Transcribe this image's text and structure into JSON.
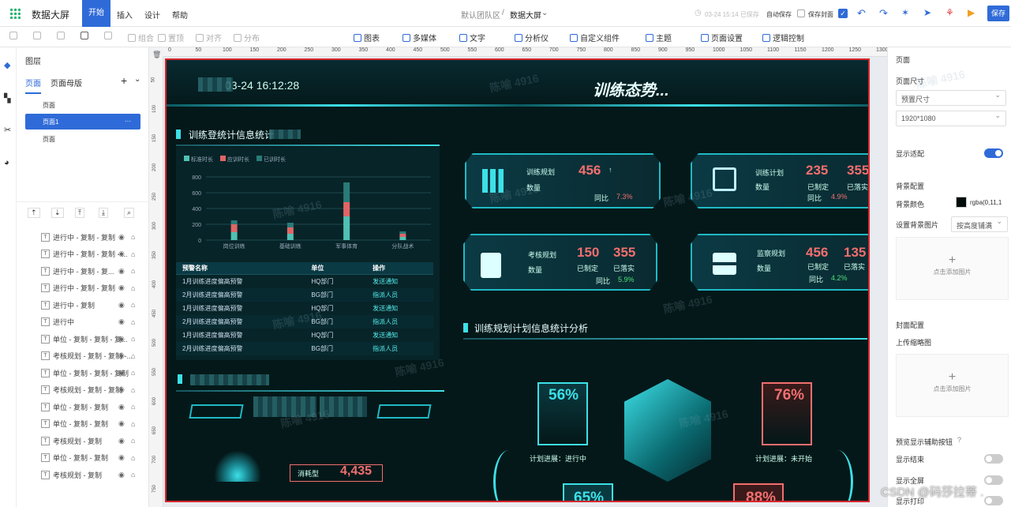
{
  "app": {
    "title": "数据大屏",
    "menu": [
      "开始",
      "插入",
      "设计",
      "帮助"
    ],
    "breadcrumb_team": "默认团队区",
    "breadcrumb_page": "数据大屏",
    "save_time": "03-24 15:14 已保存",
    "autosave": "自动保存",
    "save_cover": "保存封面",
    "save": "保存"
  },
  "toolbar": [
    "组合",
    "置顶",
    "对齐",
    "分布",
    "图表",
    "多媒体",
    "文字",
    "分析仪",
    "自定义组件",
    "主题",
    "页面设置",
    "逻辑控制"
  ],
  "layers": {
    "title": "图层",
    "tabs": [
      "页面",
      "页面母版"
    ],
    "pages": [
      "页面",
      "页面1",
      "页面"
    ],
    "items": [
      "进行中 - 复制 - 复制",
      "进行中 - 复制 - 复制 - ...",
      "进行中 - 复制 - 复...",
      "进行中 - 复制 - 复制",
      "进行中 - 复制",
      "进行中",
      "单位 - 复制 - 复制 - 复...",
      "考核规划 - 复制 - 复制 -...",
      "单位 - 复制 - 复制 - 复制",
      "考核规划 - 复制 - 复制",
      "单位 - 复制 - 复制",
      "单位 - 复制 - 复制",
      "考核规划 - 复制",
      "单位 - 复制 - 复制",
      "考核规划 - 复制"
    ]
  },
  "ruler": [
    "0",
    "50",
    "100",
    "150",
    "200",
    "250",
    "300",
    "350",
    "400",
    "450",
    "500",
    "550",
    "600",
    "650",
    "700",
    "750",
    "800",
    "850",
    "900",
    "950",
    "1000",
    "1050",
    "1100",
    "1150",
    "1200",
    "1250",
    "1300"
  ],
  "ruler_left": [
    "50",
    "100",
    "150",
    "200",
    "250",
    "300",
    "350",
    "400",
    "450",
    "500",
    "550",
    "600",
    "650",
    "700",
    "750"
  ],
  "right": {
    "page": "页面",
    "size_label": "页面尺寸",
    "size_preset": "预置尺寸",
    "size_value": "1920*1080",
    "fit": "显示适配",
    "bg_config": "背景配置",
    "bg_color": "背景颜色",
    "bg_color_value": "rgba(0,11,1",
    "bg_image": "设置背景图片",
    "bg_mode": "按高度铺满",
    "add_image": "点击添加图片",
    "cover_config": "封面配置",
    "upload_thumb": "上传缩略图",
    "preview_btns": "预览显示辅助按钮",
    "show_end": "显示结束",
    "show_full": "显示全屏",
    "show_print": "显示打印"
  },
  "screen": {
    "time": "03-24 16:12:28",
    "header": "训练态势...",
    "panel1": "训练登统计信息统计",
    "legend": [
      "标准时长",
      "应训时长",
      "已训时长"
    ],
    "chart_data": {
      "type": "bar",
      "categories": [
        "岗位训练",
        "基础训练",
        "军事体育",
        "分队战术"
      ],
      "series": [
        {
          "name": "标准时长",
          "values": [
            100,
            80,
            300,
            40
          ]
        },
        {
          "name": "应训时长",
          "values": [
            100,
            80,
            180,
            40
          ]
        },
        {
          "name": "已训时长",
          "values": [
            50,
            60,
            250,
            30
          ]
        }
      ],
      "ylim": [
        0,
        800
      ],
      "yticks": [
        "800",
        "600",
        "400",
        "200",
        "0"
      ]
    },
    "table": {
      "headers": [
        "预警名称",
        "单位",
        "操作"
      ],
      "rows": [
        [
          "1月训练进度偏高预警",
          "HQ部门",
          "发送通知"
        ],
        [
          "2月训练进度偏高预警",
          "BG部门",
          "指派人员"
        ],
        [
          "1月训练进度偏高预警",
          "HQ部门",
          "发送通知"
        ],
        [
          "2月训练进度偏高预警",
          "BG部门",
          "指派人员"
        ],
        [
          "1月训练进度偏高预警",
          "HQ部门",
          "发送通知"
        ],
        [
          "2月训练进度偏高预警",
          "BG部门",
          "指派人员"
        ]
      ]
    },
    "consume_label": "消耗型",
    "consume_value": "4,435",
    "cards": [
      {
        "title": "训练规划",
        "sub": "数量",
        "val1": "456",
        "yoy": "同比",
        "pct": "7.3%"
      },
      {
        "title": "训练计划",
        "sub": "数量",
        "val1": "235",
        "val2": "355",
        "l1": "已制定",
        "l2": "已落实",
        "yoy": "同比",
        "pct": "4.9%"
      },
      {
        "title": "考核规划",
        "sub": "数量",
        "val1": "150",
        "val2": "355",
        "l1": "已制定",
        "l2": "已落实",
        "yoy": "同比",
        "pct": "5.9%"
      },
      {
        "title": "监察规划",
        "sub": "数量",
        "val1": "456",
        "val2": "135",
        "l1": "已制定",
        "l2": "已落实",
        "yoy": "同比",
        "pct": "4.2%"
      }
    ],
    "panel2": "训练规划计划信息统计分析",
    "p56": "56%",
    "p76": "76%",
    "p65": "65%",
    "p88": "88%",
    "s56": "计划进展：进行中",
    "s76": "计划进展：未开始"
  },
  "watermark": "陈喻 4916",
  "csdn": "CSDN @码莎拉蒂 .",
  "colors": {
    "accent": "#2f6bd8",
    "cyan": "#3de0e8",
    "red": "#f26f6f",
    "frame": "#d8262d"
  }
}
